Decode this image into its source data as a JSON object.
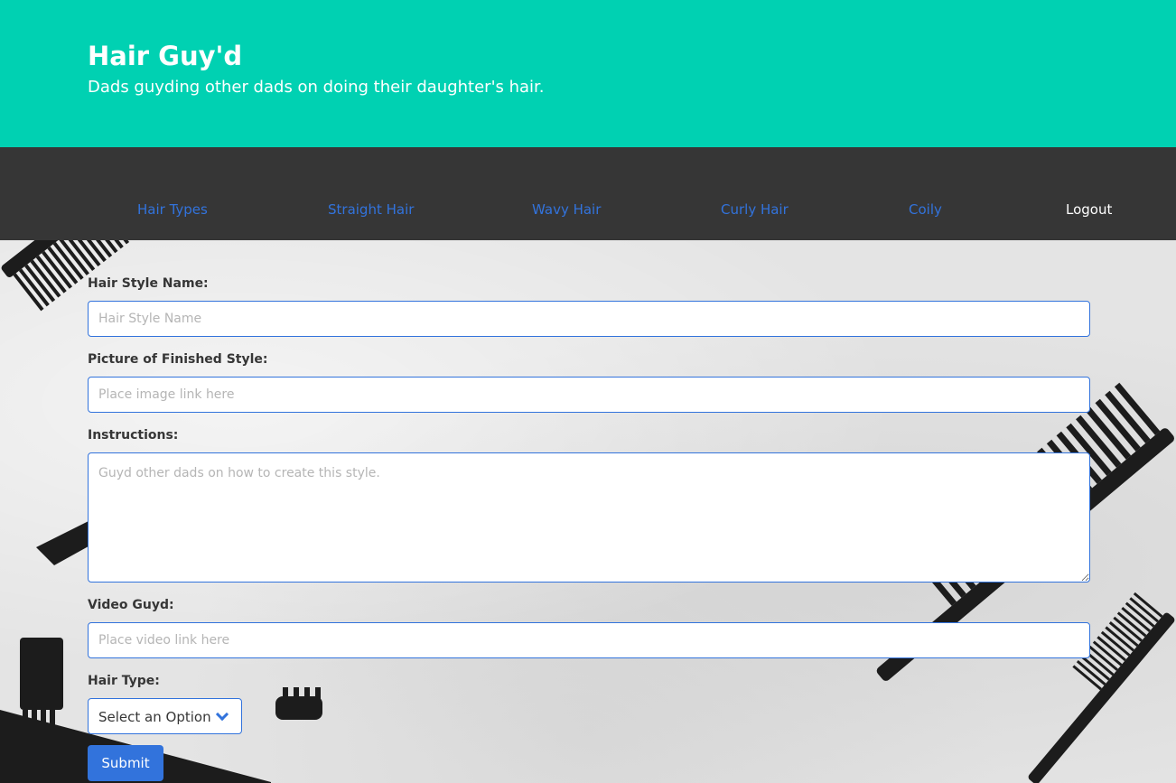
{
  "hero": {
    "title": "Hair Guy'd",
    "subtitle": "Dads guyding other dads on doing their daughter's hair."
  },
  "nav": {
    "items": [
      {
        "label": "Hair Types"
      },
      {
        "label": "Straight Hair"
      },
      {
        "label": "Wavy Hair"
      },
      {
        "label": "Curly Hair"
      },
      {
        "label": "Coily"
      },
      {
        "label": "Logout"
      }
    ]
  },
  "form": {
    "name_label": "Hair Style Name:",
    "name_placeholder": "Hair Style Name",
    "picture_label": "Picture of Finished Style:",
    "picture_placeholder": "Place image link here",
    "instructions_label": "Instructions:",
    "instructions_placeholder": "Guyd other dads on how to create this style.",
    "video_label": "Video Guyd:",
    "video_placeholder": "Place video link here",
    "hair_type_label": "Hair Type:",
    "hair_type_selected": "Select an Option",
    "submit_label": "Submit"
  },
  "colors": {
    "hero": "#00d1b2",
    "navbar": "#363636",
    "link": "#3273dc",
    "button": "#3273dc"
  },
  "icons": {
    "select_arrow": "chevron-down-icon"
  }
}
